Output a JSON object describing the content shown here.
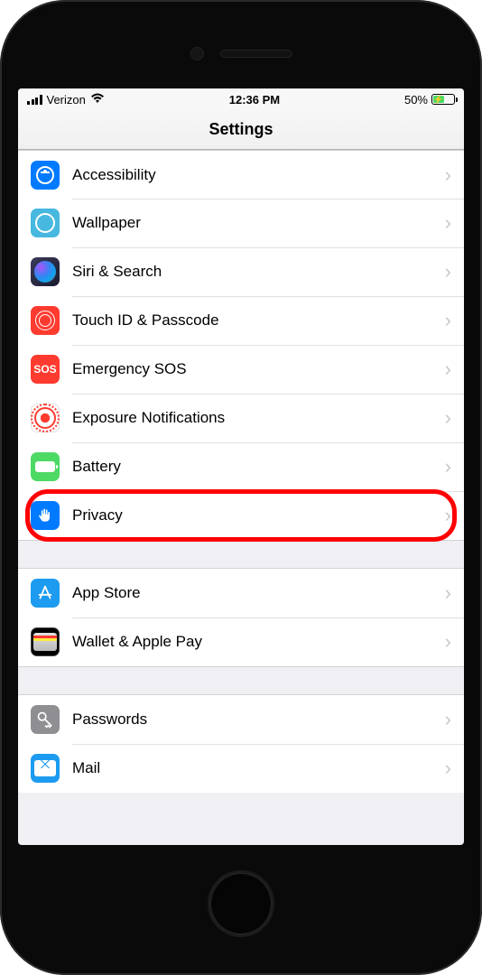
{
  "status": {
    "carrier": "Verizon",
    "time": "12:36 PM",
    "battery_pct": "50%"
  },
  "nav": {
    "title": "Settings"
  },
  "groups": [
    {
      "rows": [
        {
          "icon": "accessibility-icon",
          "label": "Accessibility"
        },
        {
          "icon": "wallpaper-icon",
          "label": "Wallpaper"
        },
        {
          "icon": "siri-icon",
          "label": "Siri & Search"
        },
        {
          "icon": "touchid-icon",
          "label": "Touch ID & Passcode"
        },
        {
          "icon": "sos-icon",
          "label": "Emergency SOS"
        },
        {
          "icon": "exposure-icon",
          "label": "Exposure Notifications"
        },
        {
          "icon": "battery-icon",
          "label": "Battery"
        },
        {
          "icon": "privacy-icon",
          "label": "Privacy",
          "highlighted": true
        }
      ]
    },
    {
      "rows": [
        {
          "icon": "appstore-icon",
          "label": "App Store"
        },
        {
          "icon": "wallet-icon",
          "label": "Wallet & Apple Pay"
        }
      ]
    },
    {
      "rows": [
        {
          "icon": "passwords-icon",
          "label": "Passwords"
        },
        {
          "icon": "mail-icon",
          "label": "Mail"
        }
      ]
    }
  ],
  "highlight_target": "Privacy"
}
